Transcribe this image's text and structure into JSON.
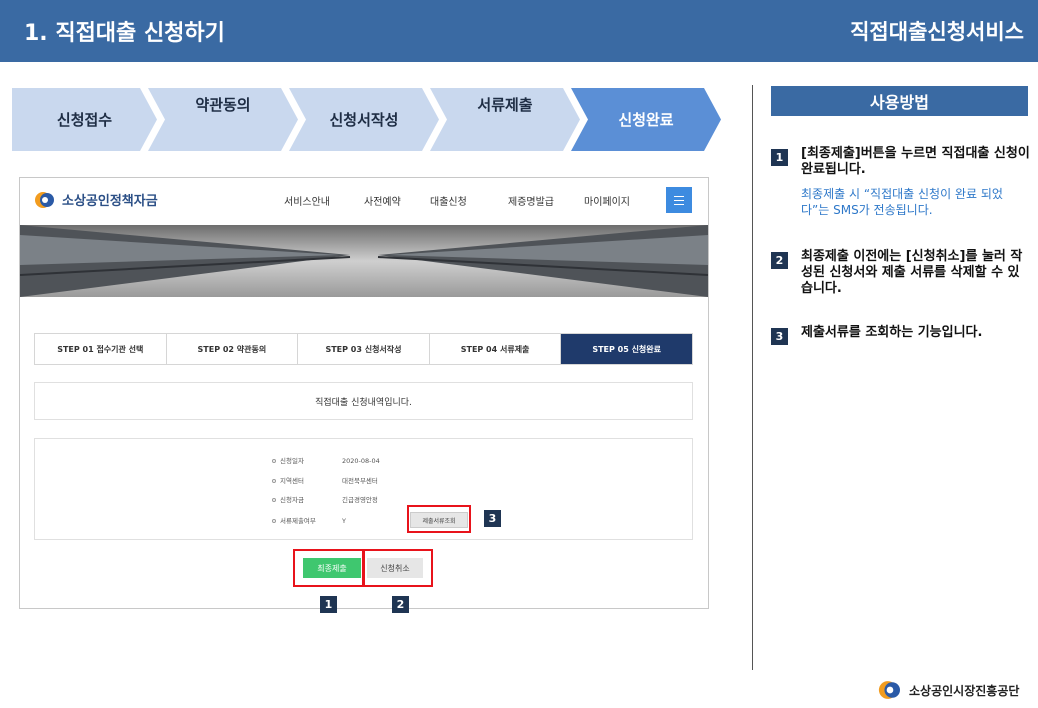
{
  "header": {
    "title": "1. 직접대출 신청하기",
    "service": "직접대출신청서비스"
  },
  "steps": [
    "신청접수",
    "약관동의",
    "신청서작성",
    "서류제출",
    "신청완료"
  ],
  "howto": {
    "title": "사용방법",
    "tips": [
      {
        "num": "1",
        "text": "[최종제출]버튼을 누르면 직접대출 신청이 완료됩니다.",
        "sub": "최종제출 시 “직접대출 신청이 완료 되었다”는 SMS가 전송됩니다."
      },
      {
        "num": "2",
        "text": "최종제출 이전에는 [신청취소]를 눌러 작성된 신청서와 제출 서류를 삭제할 수 있습니다.",
        "sub": ""
      },
      {
        "num": "3",
        "text": "제출서류를 조회하는 기능입니다.",
        "sub": ""
      }
    ]
  },
  "screenshot": {
    "logo_text": "소상공인정책자금",
    "menu": [
      "서비스안내",
      "사전예약",
      "대출신청",
      "제증명발급",
      "마이페이지"
    ],
    "stepbar": [
      "STEP 01 접수기관 선택",
      "STEP 02 약관동의",
      "STEP 03 신청서작성",
      "STEP 04 서류제출",
      "STEP 05 신청완료"
    ],
    "message": "직접대출 신청내역입니다.",
    "info": [
      {
        "label": "신청일자",
        "value": "2020-08-04"
      },
      {
        "label": "지역센터",
        "value": "대전북부센터"
      },
      {
        "label": "신청자금",
        "value": "긴급경영안정"
      },
      {
        "label": "서류제출여부",
        "value": "Y"
      }
    ],
    "doc_button": "제출서류조회",
    "final_button": "최종제출",
    "cancel_button": "신청취소",
    "badges": [
      "1",
      "2",
      "3"
    ]
  },
  "footer": {
    "org": "소상공인시장진흥공단"
  },
  "colors": {
    "header": "#3a6aa3",
    "step_inactive": "#c9d8ee",
    "step_active": "#5b8fd6",
    "highlight": "#e8131b",
    "final_button": "#3fc76f"
  }
}
